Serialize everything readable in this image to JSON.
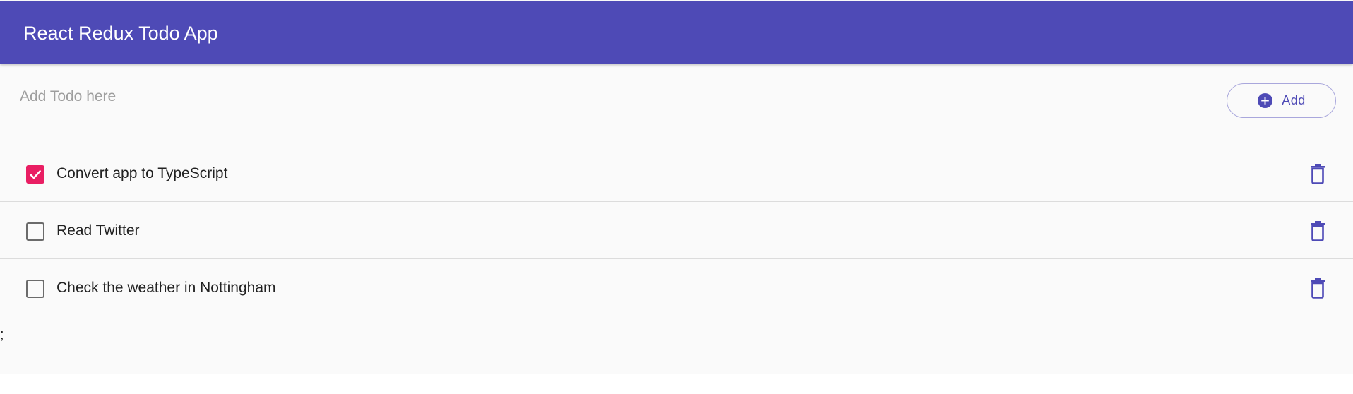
{
  "header": {
    "title": "React Redux Todo App",
    "background_color": "#4e4ab6"
  },
  "form": {
    "placeholder": "Add Todo here",
    "value": "",
    "add_button": {
      "label": "Add",
      "icon": "plus-circle-icon"
    }
  },
  "todos": [
    {
      "text": "Convert app to TypeScript",
      "completed": true
    },
    {
      "text": "Read Twitter",
      "completed": false
    },
    {
      "text": "Check the weather in Nottingham",
      "completed": false
    }
  ],
  "stray_text": ";",
  "colors": {
    "primary": "#4e4ab6",
    "checkbox_checked": "#e91e63",
    "checkbox_unchecked": "#6b6b6b",
    "delete_icon": "#4e4ab6"
  },
  "icons": {
    "delete": "trash-icon",
    "check": "check-icon"
  }
}
